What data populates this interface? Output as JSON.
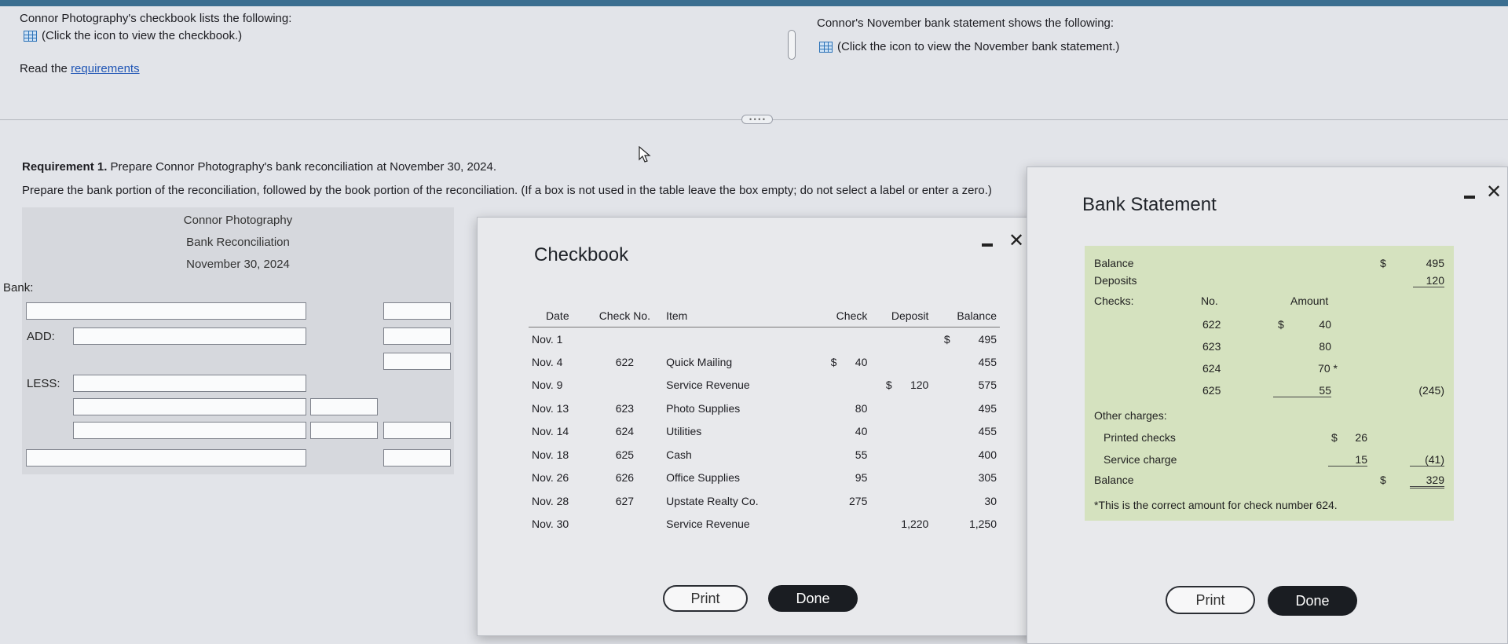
{
  "top": {
    "checkbook_intro": "Connor Photography's checkbook lists the following:",
    "checkbook_link": "(Click the icon to view the checkbook.)",
    "bank_intro": "Connor's November bank statement shows the following:",
    "bank_link": "(Click the icon to view the November bank statement.)",
    "read_prefix": "Read the",
    "read_link": "requirements"
  },
  "requirement": {
    "heading_bold": "Requirement 1.",
    "heading_text": "Prepare Connor Photography's bank reconciliation at November 30, 2024.",
    "instruction": "Prepare the bank portion of the reconciliation, followed by the book portion of the reconciliation. (If a box is not used in the table leave the box empty; do not select a label or enter a zero.)"
  },
  "reconciliation": {
    "company": "Connor Photography",
    "title": "Bank Reconciliation",
    "date": "November 30, 2024",
    "bank_label": "Bank:",
    "add_label": "ADD:",
    "less_label": "LESS:"
  },
  "checkbook": {
    "title": "Checkbook",
    "headers": [
      "Date",
      "Check No.",
      "Item",
      "Check",
      "Deposit",
      "Balance"
    ],
    "rows": [
      {
        "date": "Nov. 1",
        "no": "",
        "item": "",
        "check": "",
        "deposit": "",
        "dollar": "$",
        "balance": "495"
      },
      {
        "date": "Nov. 4",
        "no": "622",
        "item": "Quick Mailing",
        "check": "$      40",
        "deposit": "",
        "dollar": "",
        "balance": "455"
      },
      {
        "date": "Nov. 9",
        "no": "",
        "item": "Service Revenue",
        "check": "",
        "deposit": "$      120",
        "dollar": "",
        "balance": "575"
      },
      {
        "date": "Nov. 13",
        "no": "623",
        "item": "Photo Supplies",
        "check": "80",
        "deposit": "",
        "dollar": "",
        "balance": "495"
      },
      {
        "date": "Nov. 14",
        "no": "624",
        "item": "Utilities",
        "check": "40",
        "deposit": "",
        "dollar": "",
        "balance": "455"
      },
      {
        "date": "Nov. 18",
        "no": "625",
        "item": "Cash",
        "check": "55",
        "deposit": "",
        "dollar": "",
        "balance": "400"
      },
      {
        "date": "Nov. 26",
        "no": "626",
        "item": "Office Supplies",
        "check": "95",
        "deposit": "",
        "dollar": "",
        "balance": "305"
      },
      {
        "date": "Nov. 28",
        "no": "627",
        "item": "Upstate Realty Co.",
        "check": "275",
        "deposit": "",
        "dollar": "",
        "balance": "30"
      },
      {
        "date": "Nov. 30",
        "no": "",
        "item": "Service Revenue",
        "check": "",
        "deposit": "1,220",
        "dollar": "",
        "balance": "1,250"
      }
    ],
    "print_label": "Print",
    "done_label": "Done"
  },
  "bank_statement": {
    "title": "Bank Statement",
    "balance_label": "Balance",
    "balance_dollar": "$",
    "balance_value": "495",
    "deposits_label": "Deposits",
    "deposits_value": "120",
    "checks_label": "Checks:",
    "no_header": "No.",
    "amount_header": "Amount",
    "checks": [
      {
        "no": "622",
        "dollar": "$",
        "amount": "40"
      },
      {
        "no": "623",
        "dollar": "",
        "amount": "80"
      },
      {
        "no": "624",
        "dollar": "",
        "amount": "70 *"
      },
      {
        "no": "625",
        "dollar": "",
        "amount": "55"
      }
    ],
    "checks_total": "(245)",
    "other_label": "Other charges:",
    "printed_label": "Printed checks",
    "printed_dollar": "$",
    "printed_value": "26",
    "service_label": "Service charge",
    "service_value": "15",
    "other_total": "(41)",
    "end_label": "Balance",
    "end_dollar": "$",
    "end_value": "329",
    "footnote": "*This is the correct amount for check number 624.",
    "print_label": "Print",
    "done_label": "Done"
  }
}
